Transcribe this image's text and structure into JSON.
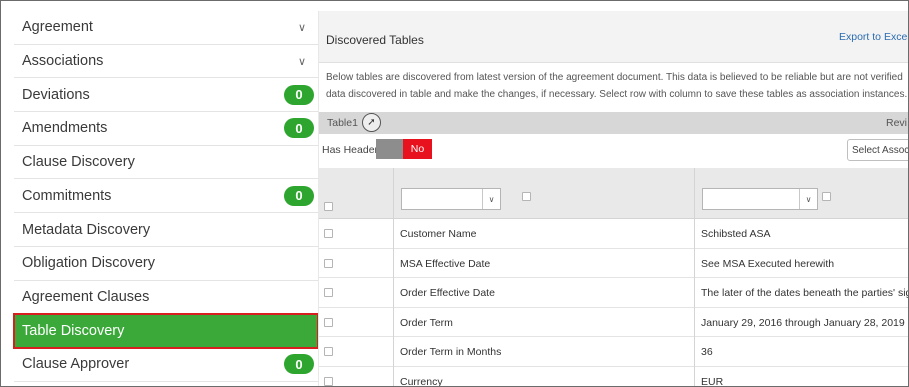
{
  "sidebar": {
    "items": [
      {
        "label": "Agreement",
        "chevron": true
      },
      {
        "label": "Associations",
        "chevron": true
      },
      {
        "label": "Deviations",
        "badge": "0"
      },
      {
        "label": "Amendments",
        "badge": "0"
      },
      {
        "label": "Clause Discovery"
      },
      {
        "label": "Commitments",
        "badge": "0"
      },
      {
        "label": "Metadata Discovery"
      },
      {
        "label": "Obligation Discovery"
      },
      {
        "label": "Agreement Clauses"
      },
      {
        "label": "Table Discovery",
        "active": true
      },
      {
        "label": "Clause Approver",
        "badge": "0"
      }
    ],
    "badge_color": "#2ea52e",
    "active_color": "#3aa93a",
    "active_outline": "#d81f1f"
  },
  "main": {
    "title": "Discovered Tables",
    "export_label": "Export to Excel",
    "description_line1": "Below tables are discovered from latest version of the agreement document. This data is believed to be reliable but are not verified",
    "description_line2": "data discovered in table and make the changes, if necessary. Select row with column to save these tables as association instances.",
    "table_name": "Table1",
    "review_label": "Revi",
    "has_header_label": "Has Header",
    "has_header_value": "No",
    "association_placeholder": "Select Assoc",
    "rows": [
      {
        "name": "Customer Name",
        "value": "Schibsted ASA"
      },
      {
        "name": "MSA Effective Date",
        "value": "See MSA Executed herewith"
      },
      {
        "name": "Order Effective Date",
        "value": "The later of the dates beneath the parties' sign"
      },
      {
        "name": "Order Term",
        "value": "January 29, 2016 through January 28, 2019"
      },
      {
        "name": "Order Term in Months",
        "value": "36"
      },
      {
        "name": "Currency",
        "value": "EUR"
      }
    ]
  }
}
